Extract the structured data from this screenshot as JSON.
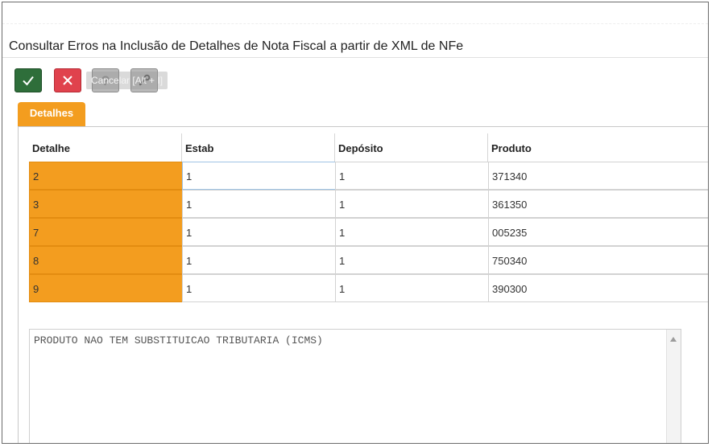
{
  "page": {
    "title": "Consultar Erros na Inclusão de Detalhes de Nota Fiscal a partir de XML de NFe"
  },
  "toolbar": {
    "confirm_icon": "check-icon",
    "cancel_icon": "close-icon",
    "help_icon": "help-icon",
    "tools_icon": "wrench-icon",
    "tooltip": "Cancelar [Alt + I]"
  },
  "tabs": [
    {
      "label": "Detalhes",
      "active": true
    }
  ],
  "grid": {
    "columns": [
      "Detalhe",
      "Estab",
      "Depósito",
      "Produto"
    ],
    "rows": [
      {
        "detalhe": "2",
        "estab": "1",
        "deposito": "1",
        "produto": "371340"
      },
      {
        "detalhe": "3",
        "estab": "1",
        "deposito": "1",
        "produto": "361350"
      },
      {
        "detalhe": "7",
        "estab": "1",
        "deposito": "1",
        "produto": "005235"
      },
      {
        "detalhe": "8",
        "estab": "1",
        "deposito": "1",
        "produto": "750340"
      },
      {
        "detalhe": "9",
        "estab": "1",
        "deposito": "1",
        "produto": "390300"
      }
    ]
  },
  "error_message": "PRODUTO NAO TEM SUBSTITUICAO TRIBUTARIA (ICMS)",
  "colors": {
    "accent_orange": "#f39d1f",
    "confirm_green": "#2e6e3a",
    "cancel_red": "#e0424d",
    "neutral_gray": "#b9b9b9"
  }
}
